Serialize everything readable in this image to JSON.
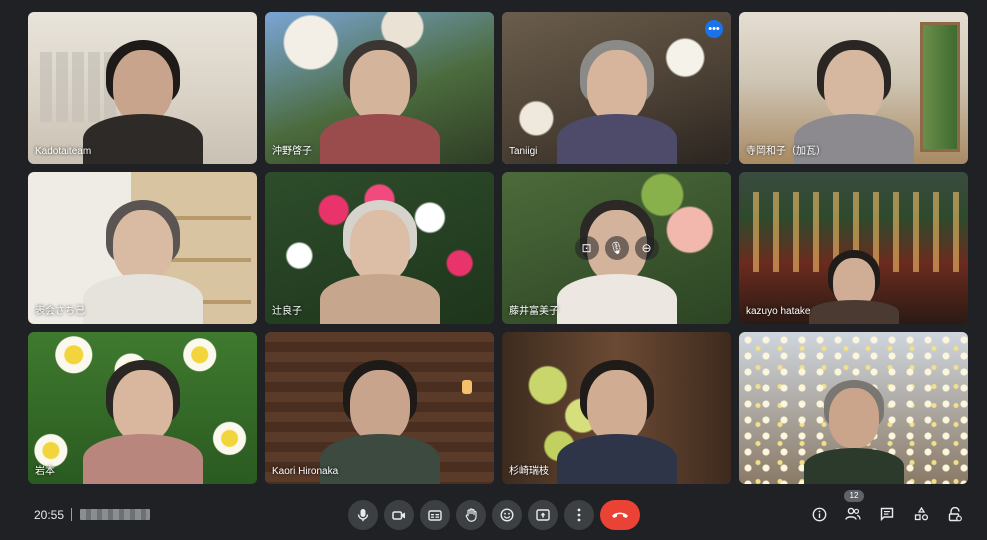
{
  "meeting": {
    "time": "20:55",
    "participant_count": "12"
  },
  "colors": {
    "background": "#202124",
    "control_button": "#3c4043",
    "hangup": "#ea4335",
    "active_speaker_border": "#8ab4f8",
    "more_button": "#1a73e8"
  },
  "participants": [
    {
      "name": "Kadotaiteam",
      "scene": "studio-interior",
      "speaking": false
    },
    {
      "name": "沖野啓子",
      "scene": "magnolia-blossoms",
      "speaking": false
    },
    {
      "name": "Taniigi",
      "scene": "plum-blossoms",
      "speaking": true
    },
    {
      "name": "寺岡和子（加瓦）",
      "scene": "wooden-room",
      "speaking": false
    },
    {
      "name": "表会さち己",
      "scene": "bookshelf-room",
      "speaking": false
    },
    {
      "name": "辻良子",
      "scene": "pink-camellias",
      "speaking": false
    },
    {
      "name": "藤井富美子",
      "scene": "camellia-tree",
      "speaking": false
    },
    {
      "name": "kazuyo hatake",
      "scene": "night-street",
      "speaking": false
    },
    {
      "name": "岩本",
      "scene": "daffodils",
      "speaking": false
    },
    {
      "name": "Kaori Hironaka",
      "scene": "log-cabin",
      "speaking": false
    },
    {
      "name": "杉崎瑞枝",
      "scene": "orchids",
      "speaking": false
    },
    {
      "name": "",
      "scene": "white-plum-tree",
      "speaking": false
    }
  ],
  "toolbar": {
    "center": [
      "mic-icon",
      "camera-icon",
      "captions-icon",
      "raise-hand-icon",
      "emoji-icon",
      "present-icon",
      "more-options-icon",
      "hangup-icon"
    ],
    "right": [
      "info-icon",
      "people-icon",
      "chat-icon",
      "activities-icon",
      "host-controls-icon"
    ]
  }
}
